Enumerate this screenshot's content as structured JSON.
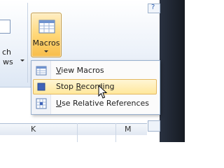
{
  "ribbon": {
    "left_group_label_line1": "ch",
    "left_group_label_line2": "ws",
    "macros_button_label": "Macros"
  },
  "menu": {
    "items": [
      {
        "prefix": "",
        "underline": "V",
        "suffix": "iew Macros",
        "icon": "view-macros-icon"
      },
      {
        "prefix": "Stop ",
        "underline": "R",
        "suffix": "ecording",
        "icon": "stop-recording-icon",
        "highlighted": true
      },
      {
        "prefix": "",
        "underline": "U",
        "suffix": "se Relative References",
        "icon": "relative-references-icon"
      }
    ]
  },
  "sheet": {
    "column_k": "K",
    "column_m": "M"
  },
  "colors": {
    "button_highlight": "#ffd777",
    "menu_hover": "#ffe79b",
    "ribbon_bg": "#eef3fa"
  }
}
